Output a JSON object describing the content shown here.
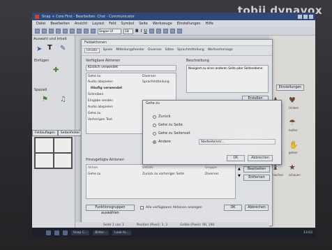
{
  "brand": "tobii dynavox",
  "window": {
    "title": "Snap + Core First - Bearbeiten: Chat - Communicator"
  },
  "menu": [
    "Datei",
    "Bearbeiten",
    "Ansicht",
    "Layout",
    "Feld",
    "Symbol",
    "Seite",
    "Werkzeuge",
    "Einstellungen",
    "Hilfe"
  ],
  "toolbar": {
    "font": "Segoe UI",
    "size": "18",
    "bold": "B",
    "italic": "I",
    "underline": "U"
  },
  "left": {
    "header": "Auswahl und Inhalt",
    "label1": "Einfügen",
    "label2": "Speziell",
    "tab1": "Feldauflagen",
    "tab2": "Seitenfelder"
  },
  "dialog": {
    "title": "Feldaktionen",
    "tabs": [
      "Inhalte",
      "Spiele",
      "Mitteilungsfenster",
      "Diverses",
      "Sätze",
      "Sprachmitteilung",
      "Wortvorhersage"
    ],
    "available_label": "Verfügbare Aktionen",
    "search": "Kürzlich verwendet",
    "description_label": "Beschreibung",
    "description_text": "Navigiert zu einer anderen Seite oder Seitenebene",
    "create_button": "Erstellen",
    "actions": [
      {
        "name": "Gehe zu",
        "group": "Diverses"
      },
      {
        "name": "Audio abspielen",
        "group": "Sprachmitteilung"
      },
      {
        "name": "Häufig verwendet",
        "group": ""
      },
      {
        "name": "Schreiben",
        "group": ""
      },
      {
        "name": "Eingabe senden",
        "group": ""
      },
      {
        "name": "Audio abspielen",
        "group": ""
      },
      {
        "name": "Gehe zu",
        "group": ""
      },
      {
        "name": "Vorherigen Text",
        "group": ""
      }
    ],
    "assigned_label": "Hinzugefügte Aktionen",
    "columns": [
      "Aktion",
      "Details",
      "Gruppe"
    ],
    "assigned": [
      {
        "action": "Gehe zu",
        "details": "Zurück zu vorheriger Seite",
        "group": "Diverses"
      }
    ],
    "edit_button": "Bearbeiten",
    "remove_button": "Entfernen",
    "func_button": "Funktionsgruppen auswählen",
    "show_all": "Alle verfügbaren Aktionen anzeigen",
    "ok": "OK",
    "cancel": "Abbrechen"
  },
  "subdialog": {
    "title": "Gehe zu",
    "options": [
      "Zurück",
      "Gehe zu Seite",
      "Gehe zu Seitenset",
      "Andere"
    ],
    "selected": "Andere",
    "dropdown": "Startseite/set/...",
    "ok": "OK",
    "cancel": "Abbrechen"
  },
  "symbols": [
    "essen",
    "trinken",
    "spielen",
    "helfen",
    "mögen",
    "gehen",
    "machen",
    "schauen"
  ],
  "symbols_button": "Einstellungen",
  "statusbar": [
    "Seite 1 von 1",
    "Position (Pixel): 3, 3",
    "Größe (Pixel): 90, 190"
  ],
  "taskbar": {
    "items": [
      "Snap C...",
      "Bilder...",
      "Look fo..."
    ],
    "time": "13:03"
  }
}
